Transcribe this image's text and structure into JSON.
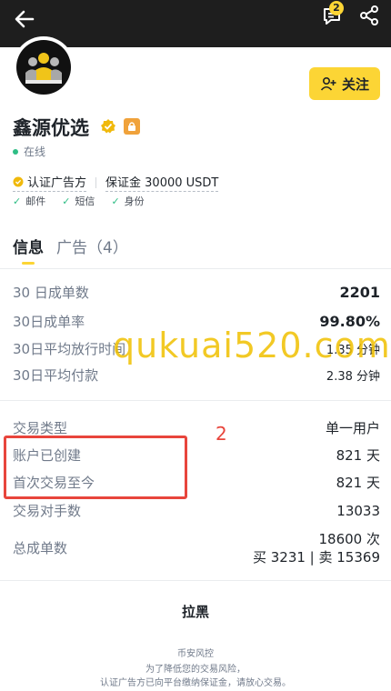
{
  "header": {
    "message_badge": "2"
  },
  "profile": {
    "name": "鑫源优选",
    "status": "在线",
    "follow_label": "关注",
    "certified": "认证广告方",
    "deposit": "保证金 30000 USDT",
    "verifications": [
      "邮件",
      "短信",
      "身份"
    ]
  },
  "tabs": {
    "info": "信息",
    "ads": "广告（4）"
  },
  "stats": [
    {
      "label": "30 日成单数",
      "value": "2201"
    },
    {
      "label": "30日成单率",
      "value": "99.80%"
    },
    {
      "label": "30日平均放行时间",
      "value": "1.35 分钟"
    },
    {
      "label": "30日平均付款",
      "value": "2.38 分钟"
    }
  ],
  "details": {
    "trade_type": {
      "label": "交易类型",
      "value": "单一用户"
    },
    "account_created": {
      "label": "账户已创建",
      "value": "821 天"
    },
    "first_trade": {
      "label": "首次交易至今",
      "value": "821 天"
    },
    "counterparties": {
      "label": "交易对手数",
      "value": "13033"
    },
    "total_orders": {
      "label": "总成单数",
      "value1": "18600 次",
      "value2": "买 3231 | 卖 15369"
    }
  },
  "annotation_number": "2",
  "watermark": "qukuai520.com",
  "footer": {
    "block_label": "拉黑",
    "risk_title": "币安风控",
    "risk_line1": "为了降低您的交易风险，",
    "risk_line2": "认证广告方已向平台缴纳保证金，请放心交易。"
  },
  "colors": {
    "accent": "#fcd535",
    "success": "#2ebd85",
    "annotation": "#e8453c"
  }
}
